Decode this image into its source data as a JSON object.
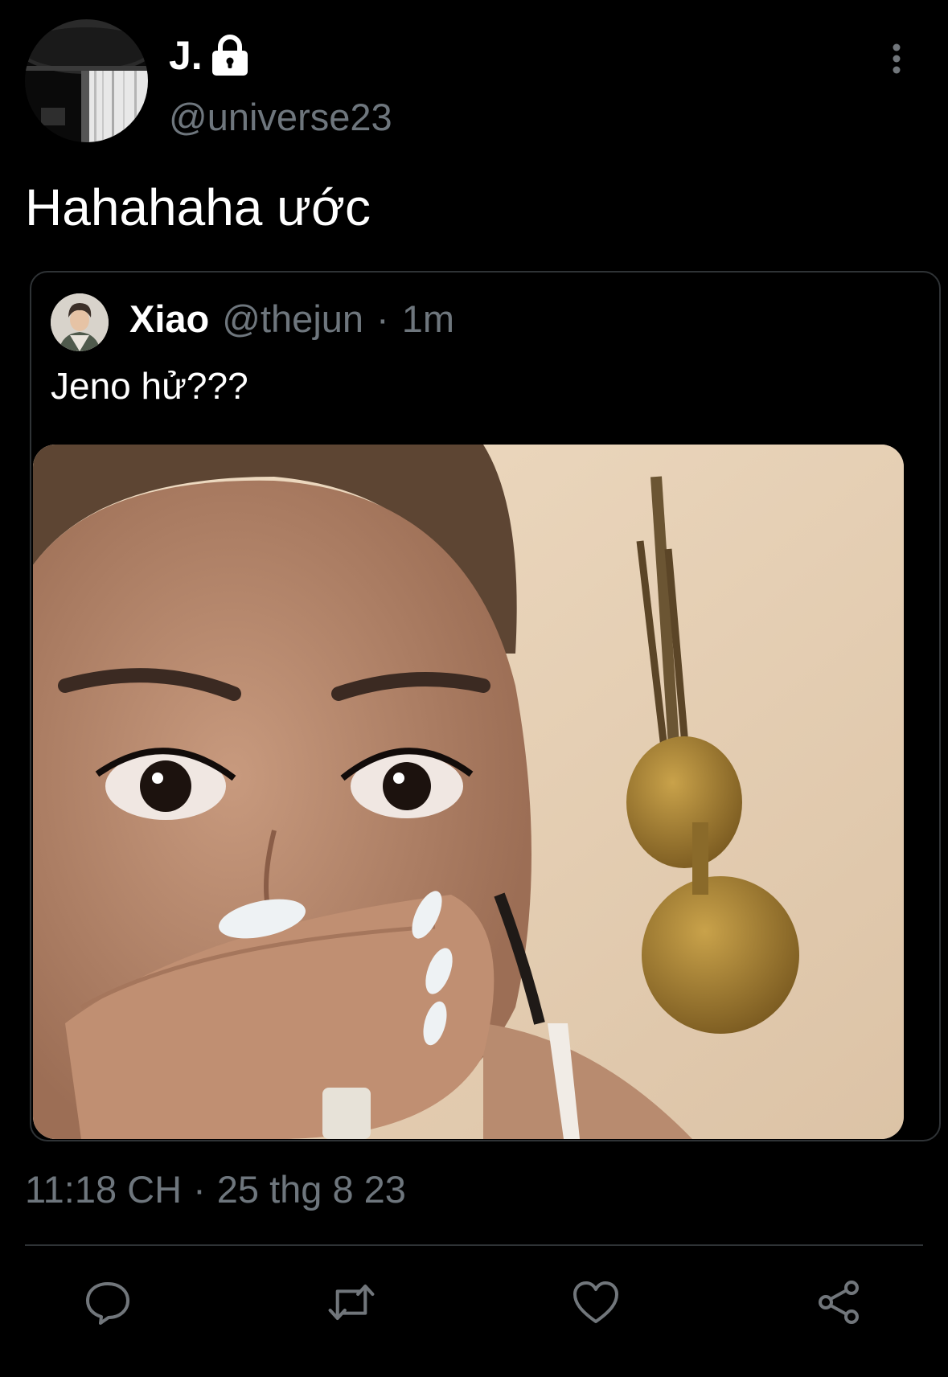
{
  "tweet": {
    "display_name": "J.",
    "handle": "@universe23",
    "text": "Hahahaha ước",
    "timestamp_time": "11:18 CH",
    "timestamp_separator": "·",
    "timestamp_date": "25 thg 8 23"
  },
  "quoted_tweet": {
    "display_name": "Xiao",
    "handle": "@thejun",
    "separator": "·",
    "time": "1m",
    "text": "Jeno hử???"
  },
  "icons": {
    "lock": "lock-icon",
    "more": "more-vertical-icon",
    "reply": "reply-icon",
    "retweet": "retweet-icon",
    "like": "heart-icon",
    "share": "share-icon"
  },
  "colors": {
    "background": "#000000",
    "primary_text": "#ffffff",
    "secondary_text": "#6e767d",
    "border": "#2f3336"
  }
}
